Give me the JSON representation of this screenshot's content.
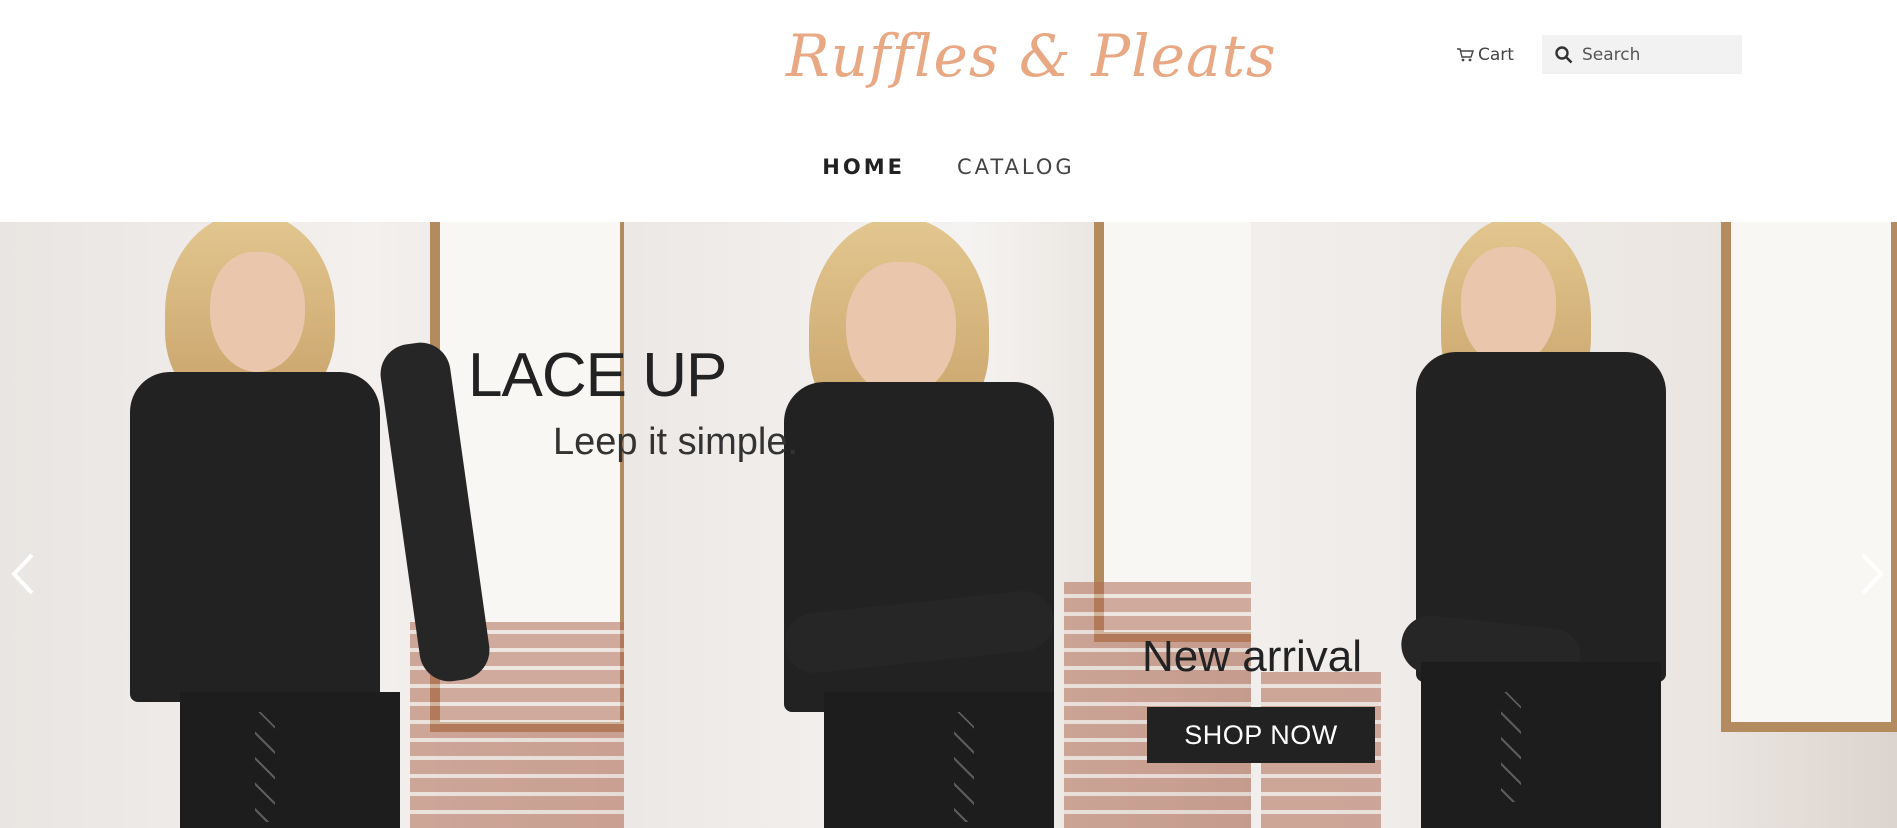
{
  "brand": {
    "logo_text": "Ruffles & Pleats",
    "logo_color": "#e8a883"
  },
  "header": {
    "cart_label": "Cart",
    "search": {
      "placeholder": "Search",
      "value": ""
    }
  },
  "nav": {
    "items": [
      {
        "label": "HOME",
        "active": true
      },
      {
        "label": "CATALOG",
        "active": false
      }
    ]
  },
  "hero": {
    "title": "LACE UP",
    "subtitle": "Leep it simple.",
    "promo_title": "New arrival",
    "cta_label": "SHOP NOW"
  },
  "icons": {
    "cart": "cart-icon",
    "search": "search-icon",
    "prev": "chevron-left-icon",
    "next": "chevron-right-icon"
  }
}
